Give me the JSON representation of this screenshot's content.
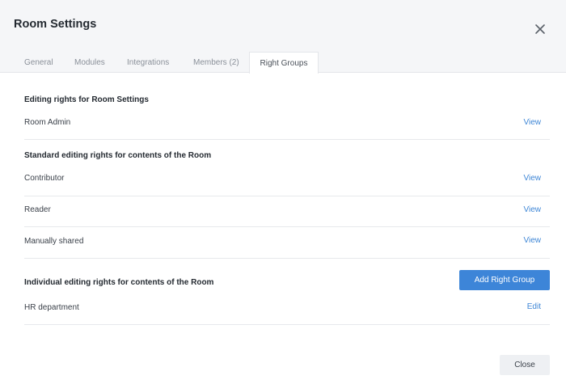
{
  "dialog": {
    "title": "Room Settings",
    "close_icon": "close-icon"
  },
  "tabs": [
    {
      "label": "General",
      "active": false
    },
    {
      "label": "Modules",
      "active": false
    },
    {
      "label": "Integrations",
      "active": false
    },
    {
      "label": "Members (2)",
      "active": false
    },
    {
      "label": "Right Groups",
      "active": true
    }
  ],
  "sections": {
    "room_settings": {
      "title": "Editing rights for Room Settings",
      "rows": [
        {
          "label": "Room Admin",
          "action": "View"
        }
      ]
    },
    "standard": {
      "title": "Standard editing rights for contents of the Room",
      "rows": [
        {
          "label": "Contributor",
          "action": "View"
        },
        {
          "label": "Reader",
          "action": "View"
        },
        {
          "label": "Manually shared",
          "action": "View"
        }
      ]
    },
    "individual": {
      "title": "Individual editing rights for contents of the Room",
      "add_button": "Add Right Group",
      "rows": [
        {
          "label": "HR department",
          "action": "Edit"
        }
      ]
    }
  },
  "footer": {
    "close_button": "Close"
  },
  "colors": {
    "accent": "#3d85d8",
    "link": "#3e86d6",
    "header_bg": "#f5f6f8"
  }
}
